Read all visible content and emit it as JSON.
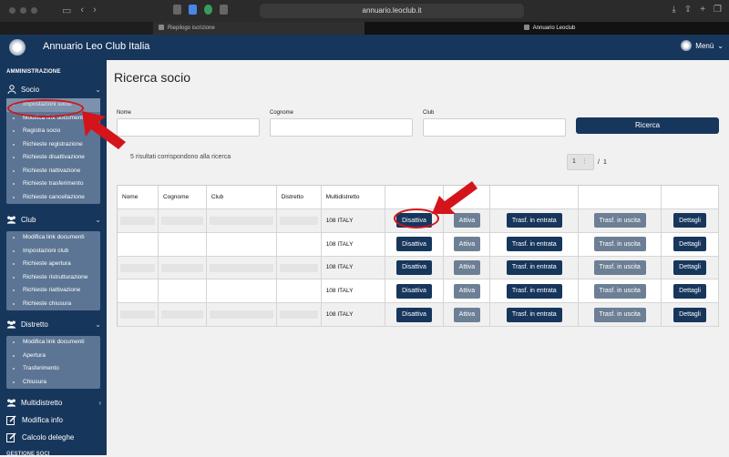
{
  "browser": {
    "url": "annuario.leoclub.it",
    "tabs": [
      {
        "label": "Riepilogo iscrizione"
      },
      {
        "label": "Annuario Leoclub"
      }
    ]
  },
  "header": {
    "title": "Annuario Leo Club Italia",
    "menu_label": "Menù"
  },
  "sidebar": {
    "section_title": "AMMINISTRAZIONE",
    "socio": {
      "label": "Socio",
      "items": [
        "Impostazioni socio",
        "Modifica link documenti",
        "Registra socio",
        "Richieste registrazione",
        "Richieste disattivazione",
        "Richieste riattivazione",
        "Richieste trasferimento",
        "Richieste cancellazione"
      ]
    },
    "club": {
      "label": "Club",
      "items": [
        "Modifica link documenti",
        "Impostazioni club",
        "Richieste apertura",
        "Richieste ristrutturazione",
        "Richieste riattivazione",
        "Richieste chiusura"
      ]
    },
    "distretto": {
      "label": "Distretto",
      "items": [
        "Modifica link documenti",
        "Apertura",
        "Trasferimento",
        "Chiusura"
      ]
    },
    "multidistretto": {
      "label": "Multidistretto"
    },
    "modifica_info": {
      "label": "Modifica info"
    },
    "calcolo_deleghe": {
      "label": "Calcolo deleghe"
    },
    "cutoff_label": "GESTIONE SOCI"
  },
  "main": {
    "title": "Ricerca socio",
    "fields": {
      "nome": {
        "label": "Nome",
        "value": ""
      },
      "cognome": {
        "label": "Cognome",
        "value": ""
      },
      "club": {
        "label": "Club",
        "value": ""
      }
    },
    "search_button": "Ricerca",
    "results_text": "5 risultati corrispondono alla ricerca",
    "pagination": {
      "current": "1",
      "separator": "/",
      "total": "1"
    },
    "table": {
      "headers": [
        "Nome",
        "Cognome",
        "Club",
        "Distretto",
        "Multidistretto",
        "",
        "",
        "",
        "",
        ""
      ],
      "actions": {
        "disattiva": "Disattiva",
        "attiva": "Attiva",
        "trasf_in": "Trasf. in entrata",
        "trasf_out": "Trasf. in uscita",
        "dettagli": "Dettagli"
      },
      "rows": [
        {
          "multidistretto": "108 ITALY"
        },
        {
          "multidistretto": "108 ITALY"
        },
        {
          "multidistretto": "108 ITALY"
        },
        {
          "multidistretto": "108 ITALY"
        },
        {
          "multidistretto": "108 ITALY"
        }
      ]
    }
  },
  "colors": {
    "navy": "#17365c",
    "submenu_bg": "#5c7594",
    "button_grey": "#6c7f95",
    "annotation_red": "#d4141b"
  }
}
